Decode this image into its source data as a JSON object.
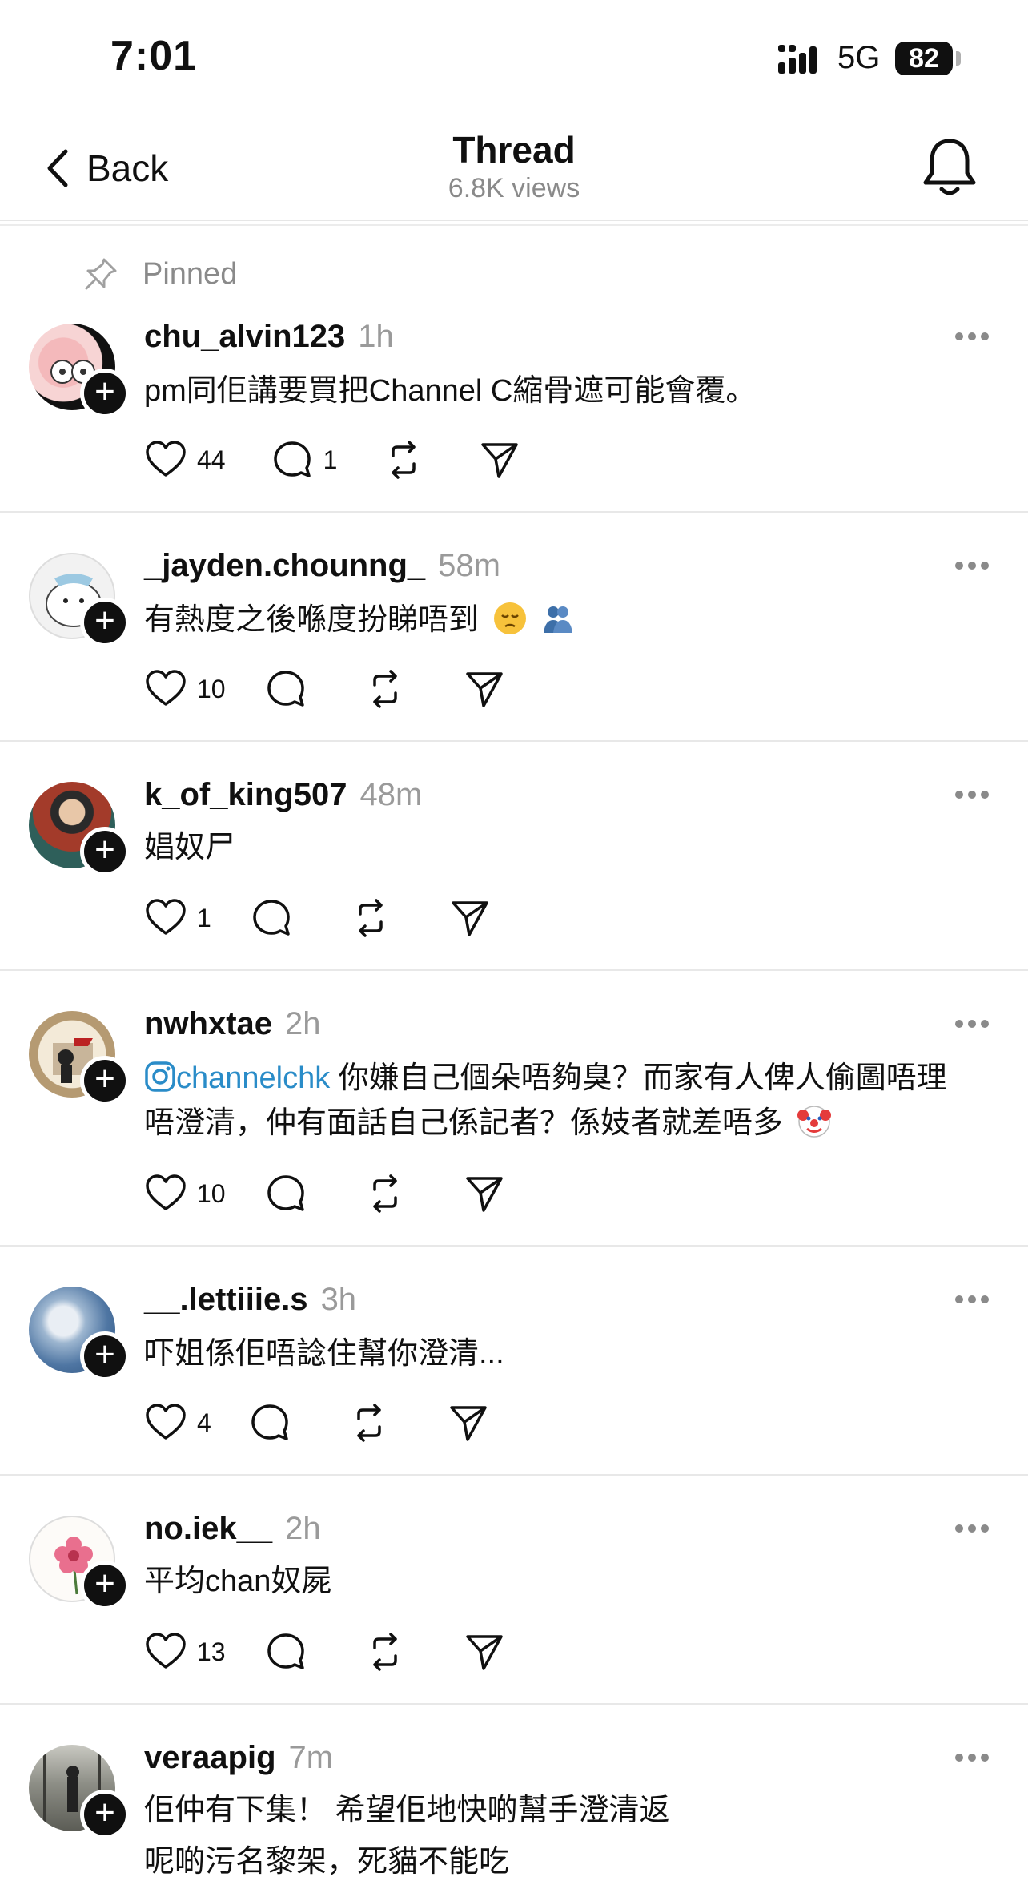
{
  "status_bar": {
    "time": "7:01",
    "network": "5G",
    "battery": "82"
  },
  "nav": {
    "back_label": "Back",
    "title": "Thread",
    "views": "6.8K views"
  },
  "pinned_label": "Pinned",
  "posts": [
    {
      "username": "chu_alvin123",
      "time": "1h",
      "text": "pm同佢講要買把Channel C縮骨遮可能會覆。",
      "likes": "44",
      "replies": "1"
    },
    {
      "username": "_jayden.chounng_",
      "time": "58m",
      "text": "有熱度之後喺度扮睇唔到",
      "likes": "10",
      "replies": ""
    },
    {
      "username": "k_of_king507",
      "time": "48m",
      "text": "娼奴尸",
      "likes": "1",
      "replies": ""
    },
    {
      "username": "nwhxtae",
      "time": "2h",
      "mention": "channelchk",
      "text": " 你嫌自己個朵唔夠臭？而家有人俾人偷圖唔理",
      "text2": "唔澄清，仲有面話自己係記者？係妓者就差唔多",
      "likes": "10",
      "replies": ""
    },
    {
      "username": "__.lettiiie.s",
      "time": "3h",
      "text": "吓姐係佢唔諗住幫你澄清...",
      "likes": "4",
      "replies": ""
    },
    {
      "username": "no.iek__",
      "time": "2h",
      "text": "平均chan奴屍",
      "likes": "13",
      "replies": ""
    },
    {
      "username": "veraapig",
      "time": "7m",
      "text": "佢仲有下集！ 希望佢地快啲幫手澄清返",
      "text2": "呢啲污名黎架，死貓不能吃"
    }
  ]
}
